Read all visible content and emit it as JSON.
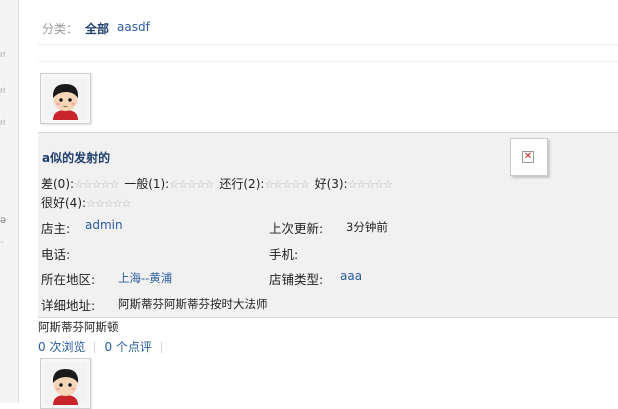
{
  "category_bar": {
    "label": "分类：",
    "all": "全部",
    "items": [
      "aasdf"
    ]
  },
  "store": {
    "title": "a似的发射的",
    "ratings": [
      {
        "label": "差(0):",
        "stars": "☆☆☆☆☆"
      },
      {
        "label": "一般(1):",
        "stars": "☆☆☆☆☆"
      },
      {
        "label": "还行(2):",
        "stars": "☆☆☆☆☆"
      },
      {
        "label": "好(3):",
        "stars": "☆☆☆☆☆"
      },
      {
        "label": "很好(4):",
        "stars": "☆☆☆☆☆"
      }
    ],
    "owner_label": "店主:",
    "owner": "admin",
    "updated_label": "上次更新:",
    "updated": "3分钟前",
    "phone_label": "电话:",
    "mobile_label": "手机:",
    "region_label": "所在地区:",
    "region": "上海--黄浦",
    "type_label": "店铺类型:",
    "type": "aaa",
    "address_label": "详细地址:",
    "address": "阿斯蒂芬阿斯蒂芬按时大法师",
    "broken_image_icon": "broken-image-icon"
  },
  "description": "阿斯蒂芬阿斯顿",
  "stats": {
    "views": "0 次浏览",
    "comments": "0 个点评"
  },
  "avatar_icon": "cartoon-avatar-icon"
}
